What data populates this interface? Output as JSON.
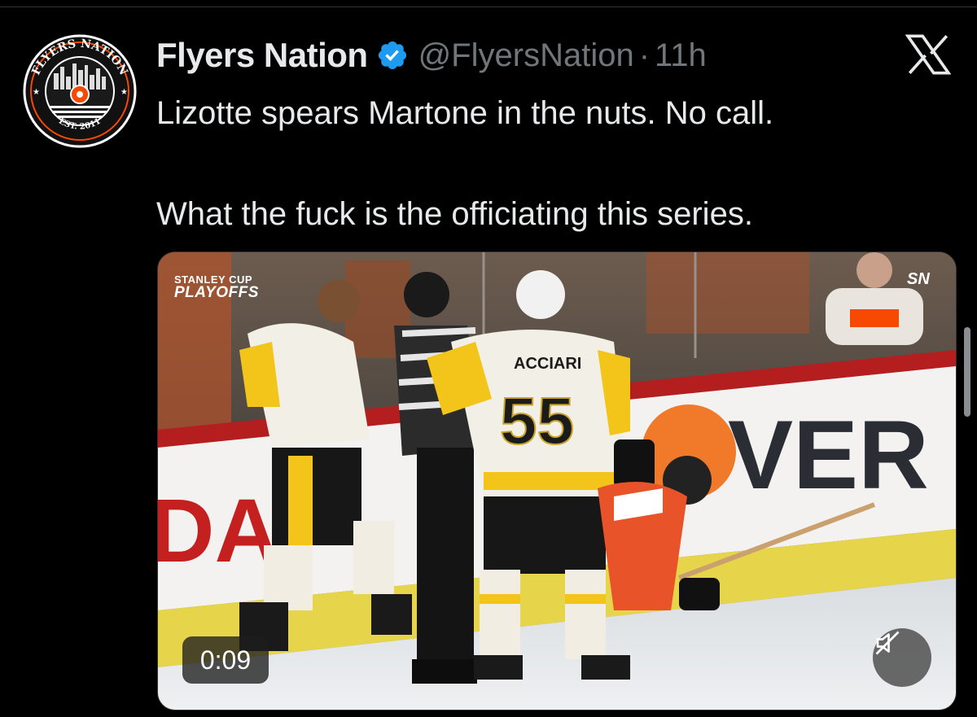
{
  "account": {
    "name": "Flyers Nation",
    "handle": "@FlyersNation",
    "time": "11h",
    "avatar_text_top": "FLYERS NATION",
    "avatar_text_bottom": "EST. 2011"
  },
  "tweet": {
    "line1": "Lizotte spears Martone in the nuts. No call.",
    "line2": "What the fuck is the officiating this series."
  },
  "media": {
    "timer": "0:09",
    "overlay_small": "STANLEY CUP",
    "overlay_big": "PLAYOFFS",
    "network_logo": "SN",
    "jersey_name": "ACCIARI",
    "jersey_number": "55",
    "board_text_left": "DA",
    "board_text_right": "VER"
  },
  "icons": {
    "verified": "verified-badge-icon",
    "x_logo": "x-logo-icon",
    "mute": "muted-speaker-icon"
  },
  "colors": {
    "background": "#000000",
    "text": "#e7e9ea",
    "muted": "#71767b",
    "verified": "#1d9bf0",
    "flyers_orange": "#f74902"
  }
}
